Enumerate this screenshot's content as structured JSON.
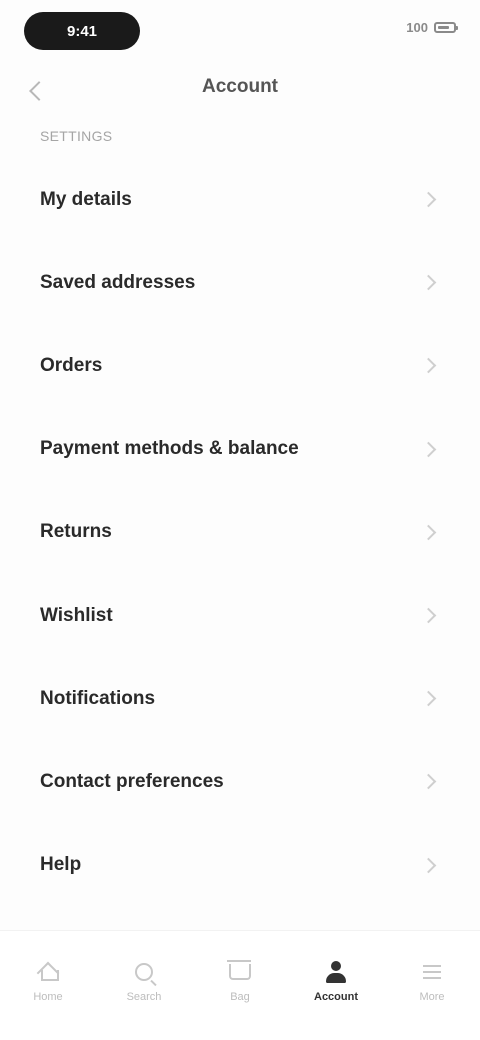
{
  "status_bar": {
    "time": "9:41",
    "battery": "100"
  },
  "header": {
    "back_label": "Back",
    "title": "Account"
  },
  "section_label": "SETTINGS",
  "items": [
    {
      "id": "my-details",
      "label": "My details"
    },
    {
      "id": "saved-addresses",
      "label": "Saved addresses"
    },
    {
      "id": "orders",
      "label": "Orders"
    },
    {
      "id": "payment-methods",
      "label": "Payment methods & balance"
    },
    {
      "id": "returns",
      "label": "Returns"
    },
    {
      "id": "wishlist",
      "label": "Wishlist"
    },
    {
      "id": "notifications",
      "label": "Notifications"
    },
    {
      "id": "contact-preferences",
      "label": "Contact preferences"
    },
    {
      "id": "help",
      "label": "Help"
    }
  ],
  "bottom_nav": [
    {
      "id": "home",
      "label": "Home",
      "icon": "home-icon",
      "active": false
    },
    {
      "id": "search",
      "label": "Search",
      "icon": "search-icon",
      "active": false
    },
    {
      "id": "bag",
      "label": "Bag",
      "icon": "cart-icon",
      "active": false
    },
    {
      "id": "account",
      "label": "Account",
      "icon": "person-icon",
      "active": true
    },
    {
      "id": "more",
      "label": "More",
      "icon": "menu-icon",
      "active": false
    }
  ]
}
